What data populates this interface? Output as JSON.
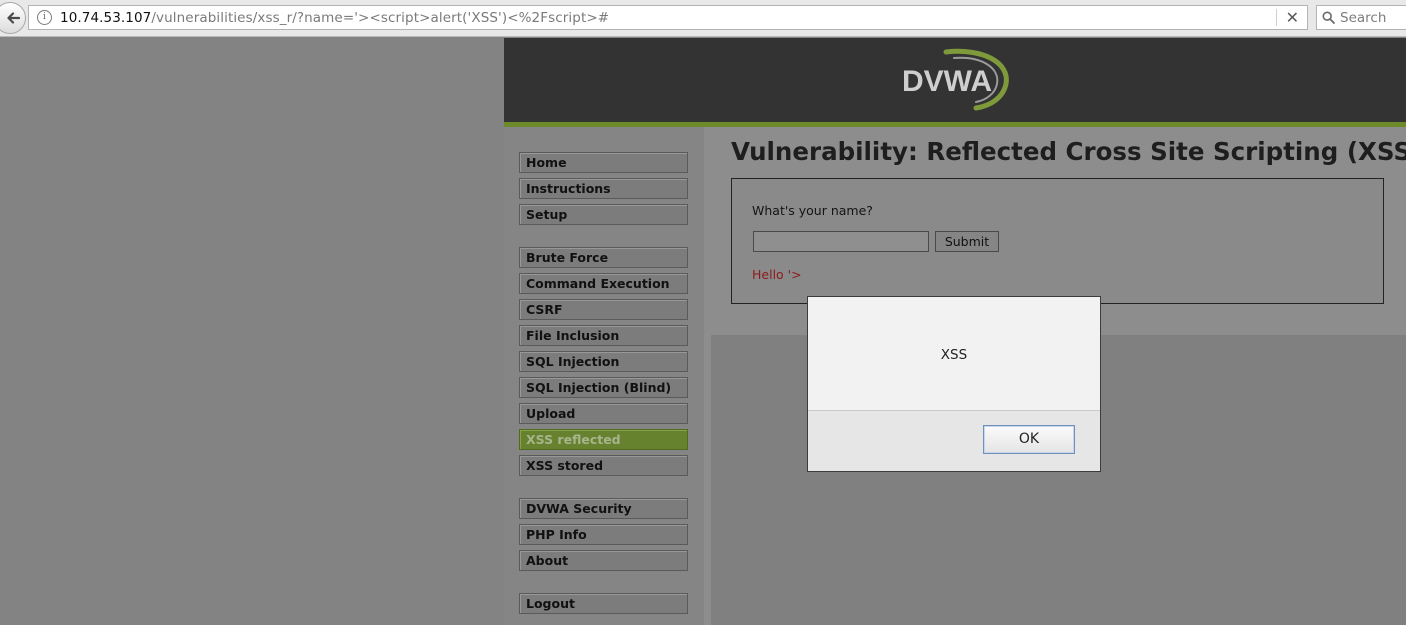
{
  "browser": {
    "url_host": "10.74.53.107",
    "url_path": "/vulnerabilities/xss_r/?name='><script>alert('XSS')<%2Fscript>#",
    "search_placeholder": "Search",
    "clear_glyph": "✕",
    "info_glyph": "i"
  },
  "header": {
    "logo_text": "DVWA"
  },
  "sidebar": {
    "items": [
      {
        "label": "Home"
      },
      {
        "label": "Instructions"
      },
      {
        "label": "Setup"
      },
      {
        "label": "Brute Force"
      },
      {
        "label": "Command Execution"
      },
      {
        "label": "CSRF"
      },
      {
        "label": "File Inclusion"
      },
      {
        "label": "SQL Injection"
      },
      {
        "label": "SQL Injection (Blind)"
      },
      {
        "label": "Upload"
      },
      {
        "label": "XSS reflected",
        "selected": true
      },
      {
        "label": "XSS stored"
      },
      {
        "label": "DVWA Security"
      },
      {
        "label": "PHP Info"
      },
      {
        "label": "About"
      },
      {
        "label": "Logout"
      }
    ]
  },
  "main": {
    "title": "Vulnerability: Reflected Cross Site Scripting (XSS)",
    "question": "What's your name?",
    "input_value": "",
    "submit_label": "Submit",
    "hello_text": "Hello '>"
  },
  "alert": {
    "message": "XSS",
    "ok_label": "OK"
  },
  "colors": {
    "accent_green": "#6c8a2a",
    "header_bg": "#333333",
    "hello_red": "#8e1a1a"
  }
}
